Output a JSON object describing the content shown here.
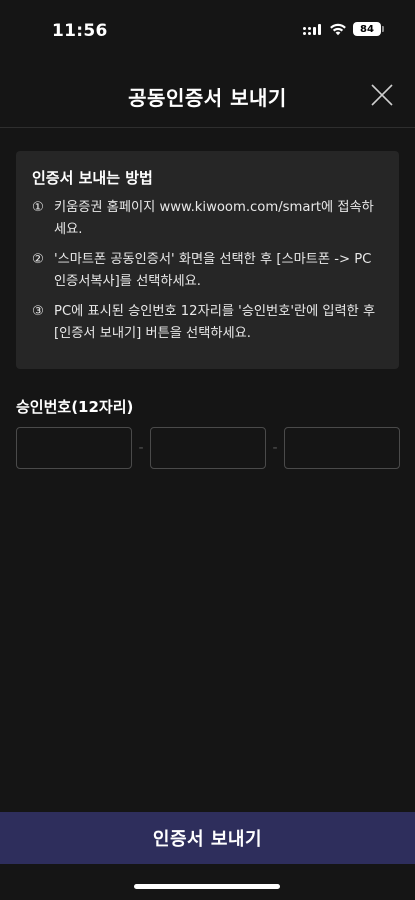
{
  "status_bar": {
    "time": "11:56",
    "battery": "84",
    "icons": [
      "signal-icon",
      "wifi-icon",
      "battery-icon"
    ]
  },
  "header": {
    "title": "공동인증서 보내기",
    "close_icon": "close-icon"
  },
  "guide": {
    "title": "인증서 보내는 방법",
    "steps": [
      {
        "num": "①",
        "text": "키움증권 홈페이지 www.kiwoom.com/smart에 접속하세요."
      },
      {
        "num": "②",
        "text": "'스마트폰 공동인증서' 화면을 선택한 후 [스마트폰 -> PC 인증서복사]를 선택하세요."
      },
      {
        "num": "③",
        "text": "PC에 표시된 승인번호 12자리를 '승인번호'란에 입력한 후 [인증서 보내기] 버튼을 선택하세요."
      }
    ]
  },
  "approval": {
    "label": "승인번호(12자리)",
    "separator": "-",
    "fields": [
      {
        "value": "",
        "placeholder": ""
      },
      {
        "value": "",
        "placeholder": ""
      },
      {
        "value": "",
        "placeholder": ""
      }
    ]
  },
  "actions": {
    "send_label": "인증서 보내기"
  },
  "colors": {
    "background": "#151515",
    "info_box": "#262626",
    "primary_button": "#2e2e5c",
    "input_border": "#4a4a4a"
  }
}
